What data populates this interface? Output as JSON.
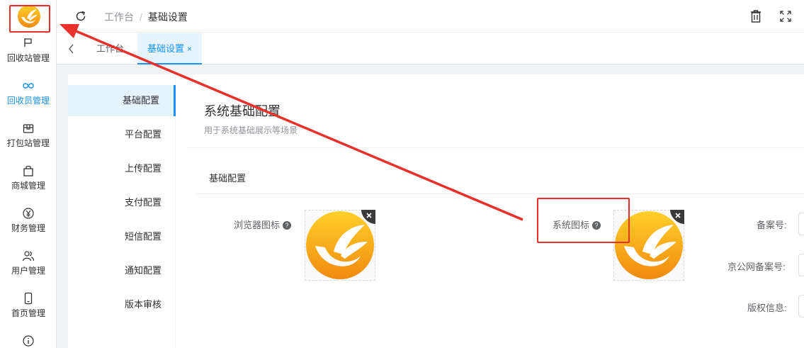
{
  "sidebar": {
    "items": [
      {
        "label": "回收站管理",
        "icon": "flag-icon",
        "active": false
      },
      {
        "label": "回收员管理",
        "icon": "infinity-icon",
        "active": true
      },
      {
        "label": "打包站管理",
        "icon": "package-icon",
        "active": false
      },
      {
        "label": "商城管理",
        "icon": "shopping-bag-icon",
        "active": false
      },
      {
        "label": "财务管理",
        "icon": "yen-icon",
        "active": false
      },
      {
        "label": "用户管理",
        "icon": "users-icon",
        "active": false
      },
      {
        "label": "首页管理",
        "icon": "mobile-icon",
        "active": false
      },
      {
        "label": "",
        "icon": "info-icon",
        "active": false
      }
    ]
  },
  "header": {
    "breadcrumb": {
      "home": "工作台",
      "separator": "/",
      "current": "基础设置"
    }
  },
  "tabs": [
    {
      "label": "工作台",
      "active": false
    },
    {
      "label": "基础设置",
      "active": true,
      "close": "×"
    }
  ],
  "settings_menu": {
    "items": [
      "基础配置",
      "平台配置",
      "上传配置",
      "支付配置",
      "短信配置",
      "通知配置",
      "版本审核"
    ],
    "active_index": 0
  },
  "main": {
    "title": "系统基础配置",
    "subtitle": "用于系统基础展示等场景",
    "section_title": "基础配置",
    "fields": {
      "browser_icon_label": "浏览器图标",
      "system_icon_label": "系统图标",
      "icp_label": "备案号:",
      "police_icp_label": "京公网备案号:",
      "copyright_label": "版权信息:"
    },
    "help_glyph": "?",
    "remove_glyph": "×"
  },
  "colors": {
    "accent": "#1890ff",
    "accent_bg": "#e6f4ff",
    "annotation": "#e8312a",
    "logo_orange": "#f7a21b",
    "logo_yellow": "#ffd02a"
  }
}
